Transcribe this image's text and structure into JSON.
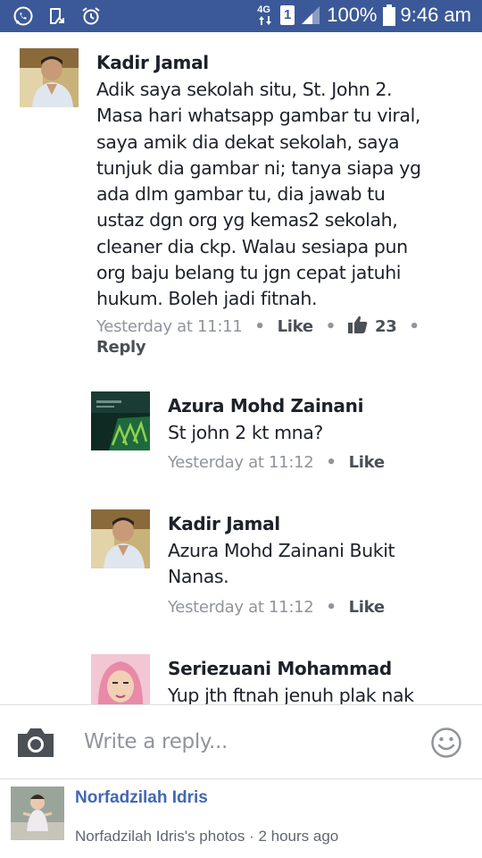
{
  "status_bar": {
    "network": "4G",
    "sim": "1",
    "battery": "100%",
    "time": "9:46 am",
    "icons": [
      "whatsapp-icon",
      "notification-icon",
      "alarm-icon",
      "signal-icon",
      "battery-icon"
    ]
  },
  "comments": [
    {
      "author": "Kadir Jamal",
      "lines": [
        "Adik saya sekolah situ, St. John 2.",
        "Masa hari whatsapp gambar tu viral,",
        "saya amik dia dekat sekolah, saya",
        "tunjuk dia gambar ni; tanya siapa yg",
        "ada dlm gambar tu, dia jawab tu",
        "ustaz dgn org yg kemas2 sekolah,",
        "cleaner dia ckp. Walau sesiapa pun",
        "org baju belang tu jgn cepat jatuhi",
        "hukum. Boleh jadi fitnah."
      ],
      "time": "Yesterday at 11:11",
      "like_label": "Like",
      "like_count": "23",
      "reply_label": "Reply",
      "avatar_icon": "person-photo"
    },
    {
      "author": "Azura Mohd Zainani",
      "lines": [
        "St john 2 kt mna?"
      ],
      "time": "Yesterday at 11:12",
      "like_label": "Like",
      "avatar_icon": "green-pattern-photo"
    },
    {
      "author": "Kadir Jamal",
      "lines": [
        "Azura Mohd Zainani Bukit",
        "Nanas."
      ],
      "time": "Yesterday at 11:12",
      "like_label": "Like",
      "avatar_icon": "person-photo"
    },
    {
      "author": "Seriezuani Mohammad",
      "lines": [
        "Yup jth ftnah jenuh plak nak"
      ],
      "avatar_icon": "hijab-woman-photo"
    }
  ],
  "reply_bar": {
    "placeholder": "Write a reply...",
    "camera_icon": "camera-icon",
    "emoji_icon": "smiley-icon"
  },
  "notification": {
    "name": "Norfadzilah Idris",
    "subtitle": "Norfadzilah Idris's photos · 2 hours ago"
  },
  "colors": {
    "status_bar": "#3b5998",
    "link_blue": "#4267b2",
    "text": "#1d2129",
    "meta": "#90949c"
  }
}
